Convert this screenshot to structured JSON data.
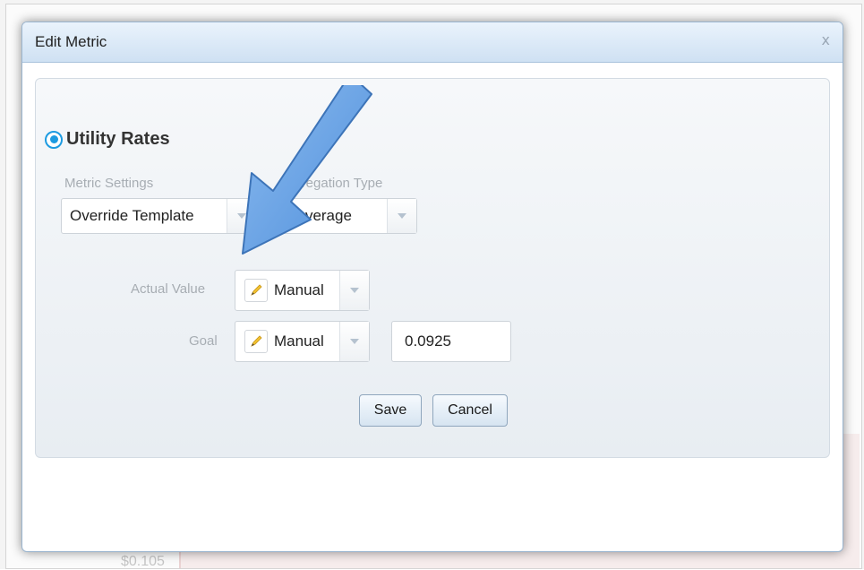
{
  "background": {
    "price_text": "$0.105"
  },
  "dialog": {
    "title": "Edit Metric",
    "close_label": "x",
    "metric_name": "Utility Rates",
    "metric_settings": {
      "label": "Metric Settings",
      "value": "Override Template"
    },
    "aggregation_type": {
      "label": "Aggregation Type",
      "icon": "left-right-arrow-icon",
      "value": "Average"
    },
    "actual_value": {
      "label": "Actual Value",
      "icon": "pencil-icon",
      "value": "Manual"
    },
    "goal": {
      "label": "Goal",
      "icon": "pencil-icon",
      "value": "Manual",
      "input_value": "0.0925"
    },
    "buttons": {
      "save": "Save",
      "cancel": "Cancel"
    }
  },
  "colors": {
    "accent_blue": "#1d9be1",
    "annotation_arrow": "#6aa6e8",
    "header_gradient_top": "#eaf3fc",
    "header_gradient_bottom": "#cfe1f3"
  }
}
